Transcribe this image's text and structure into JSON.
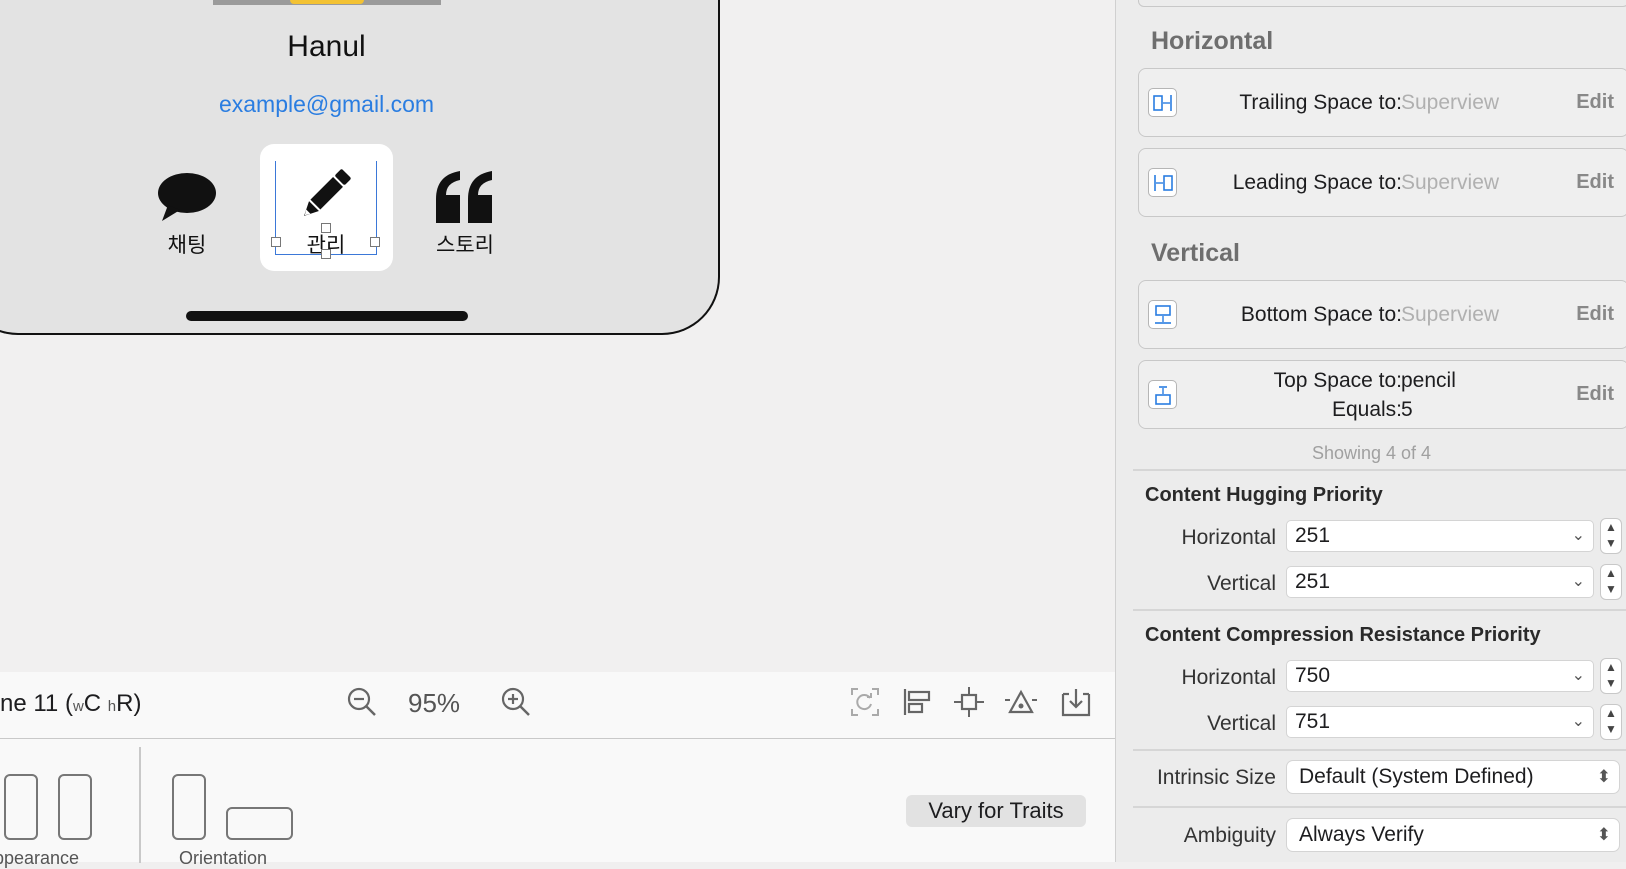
{
  "canvas": {
    "profile": {
      "name": "Hanul",
      "email": "example@gmail.com"
    },
    "actions": [
      {
        "label": "채팅",
        "icon": "speech-bubble-icon"
      },
      {
        "label": "관리",
        "icon": "pencil-icon"
      },
      {
        "label": "스토리",
        "icon": "quote-icon"
      }
    ]
  },
  "toolbar": {
    "device_prefix": "ne 11 (",
    "size_w": "w",
    "size_c": "C",
    "size_h": "h",
    "size_r": "R)",
    "zoom": "95%"
  },
  "traits": {
    "appearance_label": "ppearance",
    "orientation_label": "Orientation",
    "vary_button": "Vary for Traits"
  },
  "inspector": {
    "horizontal_title": "Horizontal",
    "vertical_title": "Vertical",
    "constraints": [
      {
        "key": "Trailing Space to:",
        "value": "Superview",
        "edit": "Edit"
      },
      {
        "key": "Leading Space to:",
        "value": "Superview",
        "edit": "Edit"
      },
      {
        "key": "Bottom Space to:",
        "value": "Superview",
        "edit": "Edit"
      },
      {
        "key": "Top Space to:",
        "value": "pencil",
        "key2": "Equals:",
        "value2": "5",
        "edit": "Edit"
      }
    ],
    "showing": "Showing 4 of 4",
    "hugging": {
      "title": "Content Hugging Priority",
      "horizontal_label": "Horizontal",
      "horizontal": "251",
      "vertical_label": "Vertical",
      "vertical": "251"
    },
    "compression": {
      "title": "Content Compression Resistance Priority",
      "horizontal_label": "Horizontal",
      "horizontal": "750",
      "vertical_label": "Vertical",
      "vertical": "751"
    },
    "intrinsic_label": "Intrinsic Size",
    "intrinsic_value": "Default (System Defined)",
    "ambiguity_label": "Ambiguity",
    "ambiguity_value": "Always Verify"
  }
}
